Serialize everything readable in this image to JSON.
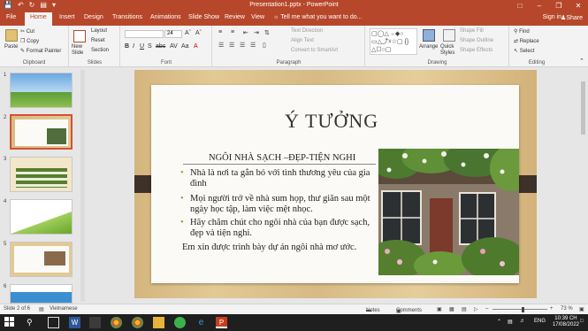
{
  "window": {
    "title": "Presentation1.pptx - PowerPoint",
    "controls": [
      "minimize",
      "restore",
      "close"
    ]
  },
  "tabs": [
    "File",
    "Home",
    "Insert",
    "Design",
    "Transitions",
    "Animations",
    "Slide Show",
    "Review",
    "View"
  ],
  "active_tab": "Home",
  "tell_me": "Tell me what you want to do...",
  "sign_in": "Sign in",
  "share": "Share",
  "ribbon": {
    "clipboard": {
      "label": "Clipboard",
      "paste": "Paste",
      "cut": "Cut",
      "copy": "Copy",
      "format_painter": "Format Painter"
    },
    "slides": {
      "label": "Slides",
      "new_slide": "New Slide",
      "layout": "Layout",
      "reset": "Reset",
      "section": "Section"
    },
    "font": {
      "label": "Font",
      "size": "24"
    },
    "paragraph": {
      "label": "Paragraph",
      "text_direction": "Text Direction",
      "align_text": "Align Text",
      "convert": "Convert to SmartArt"
    },
    "drawing": {
      "label": "Drawing",
      "arrange": "Arrange",
      "quick_styles": "Quick Styles",
      "shape_fill": "Shape Fill",
      "shape_outline": "Shape Outline",
      "shape_effects": "Shape Effects"
    },
    "editing": {
      "label": "Editing",
      "find": "Find",
      "replace": "Replace",
      "select": "Select"
    }
  },
  "thumbnails": [
    "1",
    "2",
    "3",
    "4",
    "5",
    "6"
  ],
  "selected_slide": 2,
  "slide": {
    "title": "Ý TƯỞNG",
    "subtitle": "NGÔI NHÀ SẠCH –ĐẸP-TIỆN NGHI",
    "bullets": [
      "Nhà là nơi ta gắn bó với tình thương yêu của gia đình",
      "Mọi người trở về nhà sum họp, thư giãn sau một ngày học tập, làm việc mệt nhọc.",
      "Hãy chăm chút cho ngôi nhà của bạn được sạch, đẹp và tiện nghi."
    ],
    "closing": "Em xin được trình bày dự án ngôi nhà mơ ước."
  },
  "status": {
    "slide_info": "Slide 2 of 6",
    "language": "Vietnamese",
    "notes": "Notes",
    "comments": "Comments",
    "zoom": "73 %"
  },
  "taskbar": {
    "lang": "ENG",
    "time": "10:39 CH",
    "date": "17/08/2022"
  },
  "colors": {
    "accent": "#b7472a",
    "bullet": "#8aa83a",
    "band": "#3e3127"
  }
}
